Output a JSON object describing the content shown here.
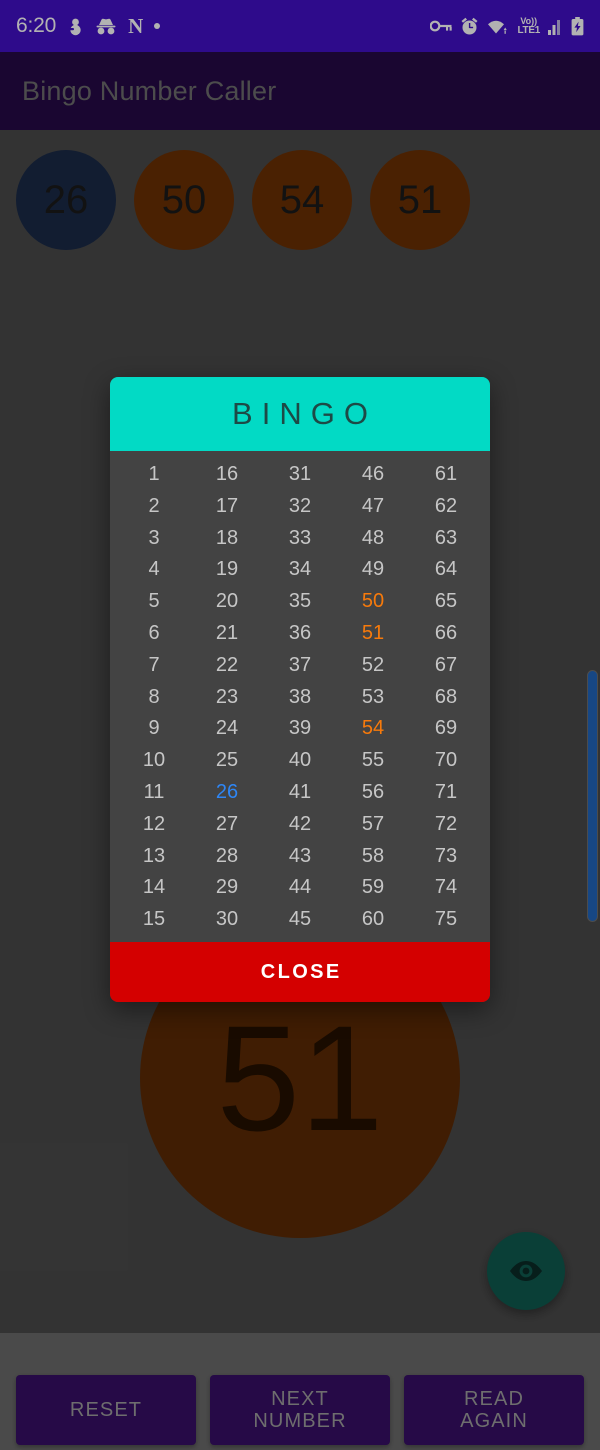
{
  "status_bar": {
    "time": "6:20",
    "left_icons": [
      "snowman-icon",
      "incognito-icon",
      "netflix-n-icon",
      "dot-icon"
    ],
    "right_icons": [
      "vpn-key-icon",
      "alarm-icon",
      "wifi-icon",
      "volte-lte-signal-icon",
      "battery-charging-icon"
    ],
    "network_line1": "Vo))",
    "network_line2": "LTE1",
    "background": "#4210C8"
  },
  "app_bar": {
    "title": "Bingo Number Caller",
    "background": "#260A47",
    "title_color": "#6e6e6e"
  },
  "called_chips": [
    {
      "value": "26",
      "color": "#1A2A47"
    },
    {
      "value": "50",
      "color": "#6B3004"
    },
    {
      "value": "54",
      "color": "#6B3004"
    },
    {
      "value": "51",
      "color": "#6B3004"
    }
  ],
  "current_number": {
    "value": "51",
    "circle_color": "#5C2A05"
  },
  "fab": {
    "icon": "eye-icon",
    "background": "#0F5B50"
  },
  "scrollbar": {
    "color": "#2166BE"
  },
  "bottom_buttons": [
    {
      "label": "RESET"
    },
    {
      "label": "NEXT\nNUMBER"
    },
    {
      "label": "READ\nAGAIN"
    }
  ],
  "dialog": {
    "title": "BINGO",
    "header_color": "#02DAC5",
    "close_label": "CLOSE",
    "close_color": "#D40000",
    "called_color": "#F77A0B",
    "current_color": "#2E86F5",
    "default_color": "#c6c6c6",
    "columns": [
      [
        "1",
        "2",
        "3",
        "4",
        "5",
        "6",
        "7",
        "8",
        "9",
        "10",
        "11",
        "12",
        "13",
        "14",
        "15"
      ],
      [
        "16",
        "17",
        "18",
        "19",
        "20",
        "21",
        "22",
        "23",
        "24",
        "25",
        "26",
        "27",
        "28",
        "29",
        "30"
      ],
      [
        "31",
        "32",
        "33",
        "34",
        "35",
        "36",
        "37",
        "38",
        "39",
        "40",
        "41",
        "42",
        "43",
        "44",
        "45"
      ],
      [
        "46",
        "47",
        "48",
        "49",
        "50",
        "51",
        "52",
        "53",
        "54",
        "55",
        "56",
        "57",
        "58",
        "59",
        "60"
      ],
      [
        "61",
        "62",
        "63",
        "64",
        "65",
        "66",
        "67",
        "68",
        "69",
        "70",
        "71",
        "72",
        "73",
        "74",
        "75"
      ]
    ],
    "called_numbers": [
      "50",
      "51",
      "54"
    ],
    "current_highlight": "26"
  }
}
